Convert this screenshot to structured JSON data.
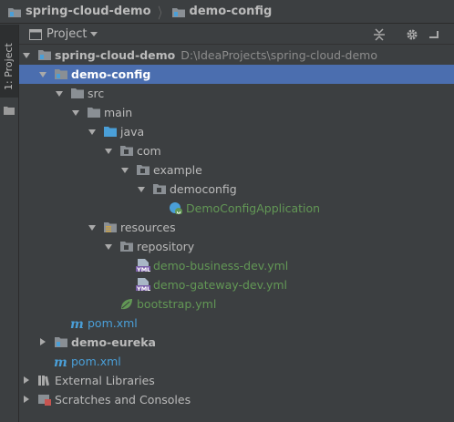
{
  "breadcrumb": [
    {
      "label": "spring-cloud-demo"
    },
    {
      "label": "demo-config"
    }
  ],
  "sidebar": {
    "tab_label": "1: Project"
  },
  "project_panel": {
    "title": "Project"
  },
  "tree": {
    "root_label": "spring-cloud-demo",
    "root_path": "D:\\IdeaProjects\\spring-cloud-demo",
    "demo_config": "demo-config",
    "src": "src",
    "main": "main",
    "java": "java",
    "com": "com",
    "example": "example",
    "democonfig": "democonfig",
    "app_class": "DemoConfigApplication",
    "resources": "resources",
    "repository": "repository",
    "business_yml": "demo-business-dev.yml",
    "gateway_yml": "demo-gateway-dev.yml",
    "bootstrap_yml": "bootstrap.yml",
    "config_pom": "pom.xml",
    "demo_eureka": "demo-eureka",
    "root_pom": "pom.xml",
    "external_libs": "External Libraries",
    "scratches": "Scratches and Consoles"
  },
  "colors": {
    "background": "#3c3f41",
    "selection": "#4b6eaf",
    "text": "#bbbbbb",
    "config_file_text": "#629755",
    "folder": "#8a8f94",
    "source_folder": "#4a9fd8"
  }
}
